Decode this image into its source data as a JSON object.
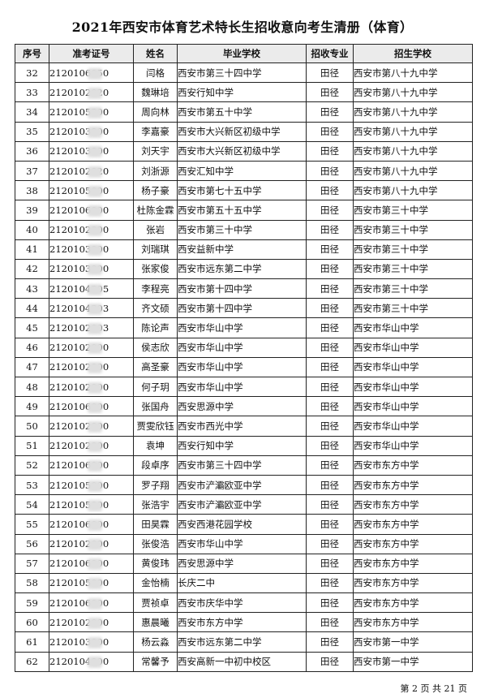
{
  "title": "2021年西安市体育艺术特长生招收意向考生清册（体育）",
  "columns": [
    "序号",
    "准考证号",
    "姓名",
    "毕业学校",
    "招收专业",
    "招生学校"
  ],
  "rows": [
    {
      "no": "32",
      "id": "2120106050",
      "name": "闫格",
      "grad": "西安市第三十四中学",
      "major": "田径",
      "adm": "西安市第八十九中学"
    },
    {
      "no": "33",
      "id": "2120102020",
      "name": "魏琳培",
      "grad": "西安行知中学",
      "major": "田径",
      "adm": "西安市第八十九中学"
    },
    {
      "no": "34",
      "id": "2120105300",
      "name": "周向林",
      "grad": "西安市第五十中学",
      "major": "田径",
      "adm": "西安市第八十九中学"
    },
    {
      "no": "35",
      "id": "2120103000",
      "name": "李嘉豪",
      "grad": "西安市大兴新区初级中学",
      "major": "田径",
      "adm": "西安市第八十九中学"
    },
    {
      "no": "36",
      "id": "2120103000",
      "name": "刘天宇",
      "grad": "西安市大兴新区初级中学",
      "major": "田径",
      "adm": "西安市第八十九中学"
    },
    {
      "no": "37",
      "id": "2120102020",
      "name": "刘浙源",
      "grad": "西安汇知中学",
      "major": "田径",
      "adm": "西安市第八十九中学"
    },
    {
      "no": "38",
      "id": "2120105000",
      "name": "杨子豪",
      "grad": "西安市第七十五中学",
      "major": "田径",
      "adm": "西安市第八十九中学"
    },
    {
      "no": "39",
      "id": "2120106000",
      "name": "杜陈金霖",
      "grad": "西安市第五十五中学",
      "major": "田径",
      "adm": "西安市第三十中学"
    },
    {
      "no": "40",
      "id": "2120102000",
      "name": "张岩",
      "grad": "西安市第三十中学",
      "major": "田径",
      "adm": "西安市第三十中学"
    },
    {
      "no": "41",
      "id": "2120103000",
      "name": "刘瑞琪",
      "grad": "西安益新中学",
      "major": "田径",
      "adm": "西安市第三十中学"
    },
    {
      "no": "42",
      "id": "2120103000",
      "name": "张家俊",
      "grad": "西安市远东第二中学",
      "major": "田径",
      "adm": "西安市第三十中学"
    },
    {
      "no": "43",
      "id": "2120104305",
      "name": "李程亮",
      "grad": "西安市第十四中学",
      "major": "田径",
      "adm": "西安市第三十中学"
    },
    {
      "no": "44",
      "id": "2120104303",
      "name": "齐文硕",
      "grad": "西安市第十四中学",
      "major": "田径",
      "adm": "西安市第三十中学"
    },
    {
      "no": "45",
      "id": "2120102003",
      "name": "陈论声",
      "grad": "西安市华山中学",
      "major": "田径",
      "adm": "西安市华山中学"
    },
    {
      "no": "46",
      "id": "2120102000",
      "name": "侯志欣",
      "grad": "西安市华山中学",
      "major": "田径",
      "adm": "西安市华山中学"
    },
    {
      "no": "47",
      "id": "2120102000",
      "name": "高圣豪",
      "grad": "西安市华山中学",
      "major": "田径",
      "adm": "西安市华山中学"
    },
    {
      "no": "48",
      "id": "2120102000",
      "name": "何子玥",
      "grad": "西安市华山中学",
      "major": "田径",
      "adm": "西安市华山中学"
    },
    {
      "no": "49",
      "id": "2120106000",
      "name": "张国舟",
      "grad": "西安思源中学",
      "major": "田径",
      "adm": "西安市华山中学"
    },
    {
      "no": "50",
      "id": "2120102000",
      "name": "贾雯欣钰",
      "grad": "西安市西光中学",
      "major": "田径",
      "adm": "西安市华山中学"
    },
    {
      "no": "51",
      "id": "2120102000",
      "name": "袁坤",
      "grad": "西安行知中学",
      "major": "田径",
      "adm": "西安市华山中学"
    },
    {
      "no": "52",
      "id": "2120106000",
      "name": "段卓序",
      "grad": "西安市第三十四中学",
      "major": "田径",
      "adm": "西安市东方中学"
    },
    {
      "no": "53",
      "id": "2120105000",
      "name": "罗子翔",
      "grad": "西安市浐灞欧亚中学",
      "major": "田径",
      "adm": "西安市东方中学"
    },
    {
      "no": "54",
      "id": "2120105000",
      "name": "张浩宇",
      "grad": "西安市浐灞欧亚中学",
      "major": "田径",
      "adm": "西安市东方中学"
    },
    {
      "no": "55",
      "id": "2120106000",
      "name": "田昊霖",
      "grad": "西安西港花园学校",
      "major": "田径",
      "adm": "西安市东方中学"
    },
    {
      "no": "56",
      "id": "2120102000",
      "name": "张俊浩",
      "grad": "西安市华山中学",
      "major": "田径",
      "adm": "西安市东方中学"
    },
    {
      "no": "57",
      "id": "2120106000",
      "name": "黄俊玮",
      "grad": "西安思源中学",
      "major": "田径",
      "adm": "西安市东方中学"
    },
    {
      "no": "58",
      "id": "2120105000",
      "name": "金怡楠",
      "grad": "长庆二中",
      "major": "田径",
      "adm": "西安市东方中学"
    },
    {
      "no": "59",
      "id": "2120106000",
      "name": "贾祯卓",
      "grad": "西安市庆华中学",
      "major": "田径",
      "adm": "西安市东方中学"
    },
    {
      "no": "60",
      "id": "2120102000",
      "name": "惠晨曦",
      "grad": "西安市东方中学",
      "major": "田径",
      "adm": "西安市东方中学"
    },
    {
      "no": "61",
      "id": "2120103000",
      "name": "杨云淼",
      "grad": "西安市远东第二中学",
      "major": "田径",
      "adm": "西安市第一中学"
    },
    {
      "no": "62",
      "id": "2120104000",
      "name": "常馨予",
      "grad": "西安高新一中初中校区",
      "major": "田径",
      "adm": "西安市第一中学"
    }
  ],
  "footer": "第 2 页 共 21 页"
}
